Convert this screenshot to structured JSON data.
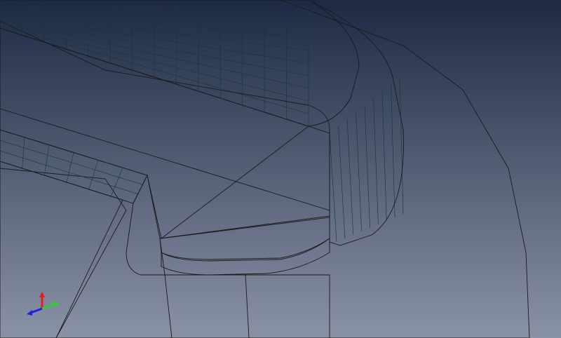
{
  "viewport": {
    "background_top": "#1e2a44",
    "background_bottom": "#8a92a6"
  },
  "colors": {
    "housing": "#9a9a00",
    "housing_edge": "#5e5e00",
    "left_block": "#ffff44",
    "left_block_side": "#b8b800",
    "part_top": "#00e600",
    "part_side": "#00c800",
    "stem": "#00b000",
    "seal_mesh": "#33e6e6",
    "seal_mesh_dark": "#1fb5b5"
  },
  "triad": {
    "axes": [
      {
        "name": "x-axis",
        "color": "#2bd22b"
      },
      {
        "name": "y-axis",
        "color": "#e02020"
      },
      {
        "name": "z-axis",
        "color": "#2020e0"
      }
    ]
  }
}
